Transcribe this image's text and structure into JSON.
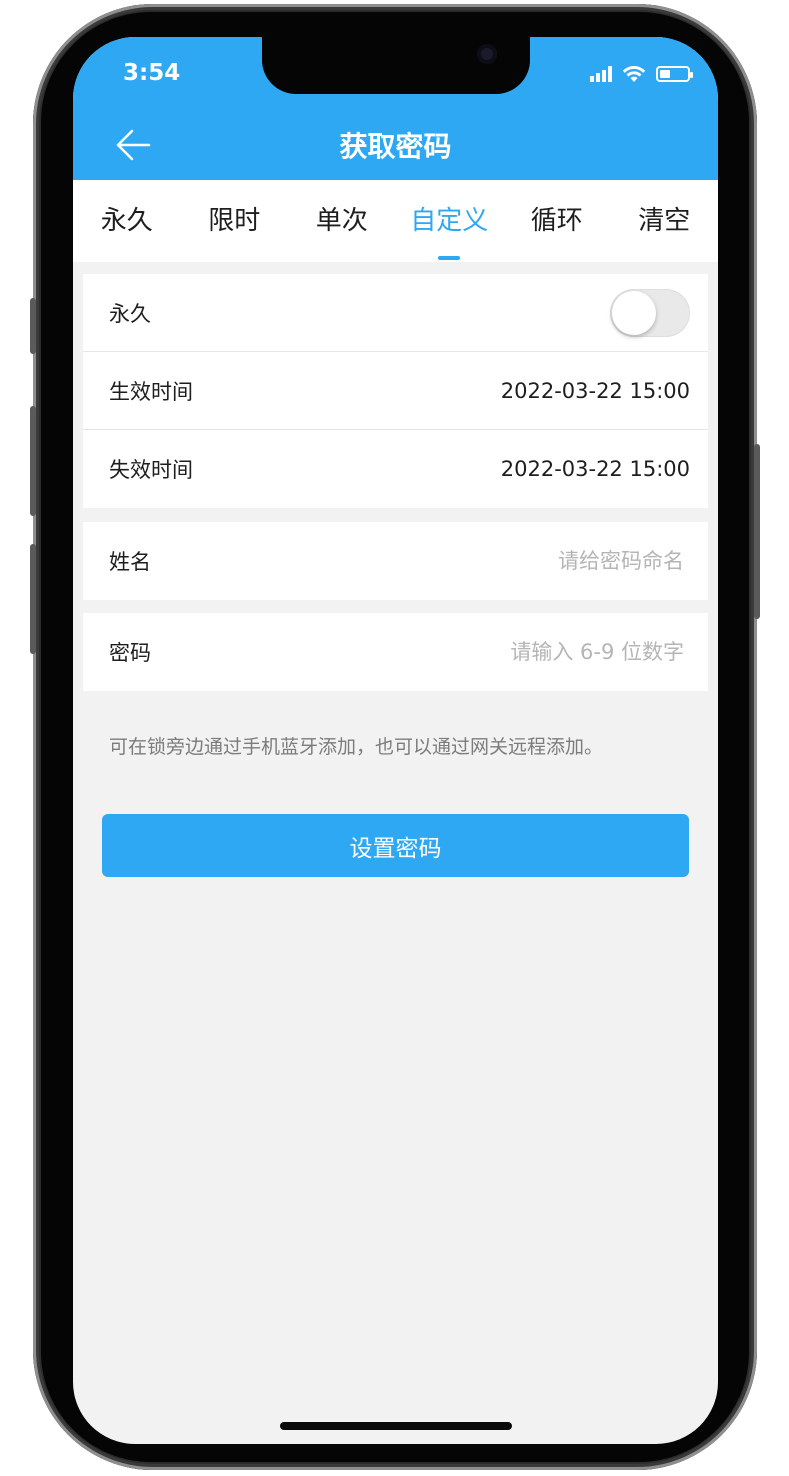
{
  "status_bar": {
    "time": "3:54",
    "icons": [
      "signal-icon",
      "wifi-icon",
      "battery-icon"
    ]
  },
  "nav": {
    "back_icon": "arrow-left-icon",
    "title": "获取密码"
  },
  "tabs": [
    {
      "label": "永久",
      "active": false
    },
    {
      "label": "限时",
      "active": false
    },
    {
      "label": "单次",
      "active": false
    },
    {
      "label": "自定义",
      "active": true
    },
    {
      "label": "循环",
      "active": false
    },
    {
      "label": "清空",
      "active": false
    }
  ],
  "settings": {
    "permanent": {
      "label": "永久",
      "enabled": false
    },
    "start_time": {
      "label": "生效时间",
      "value": "2022-03-22 15:00"
    },
    "end_time": {
      "label": "失效时间",
      "value": "2022-03-22 15:00"
    }
  },
  "name_field": {
    "label": "姓名",
    "placeholder": "请给密码命名",
    "value": ""
  },
  "password_field": {
    "label": "密码",
    "placeholder": "请输入 6-9 位数字",
    "value": ""
  },
  "hint": "可在锁旁边通过手机蓝牙添加，也可以通过网关远程添加。",
  "submit_label": "设置密码",
  "colors": {
    "accent": "#2ea8f2",
    "background": "#f2f2f2",
    "text": "#1e1e1e",
    "placeholder": "#b5b5b5",
    "hint": "#7c7c7c"
  }
}
